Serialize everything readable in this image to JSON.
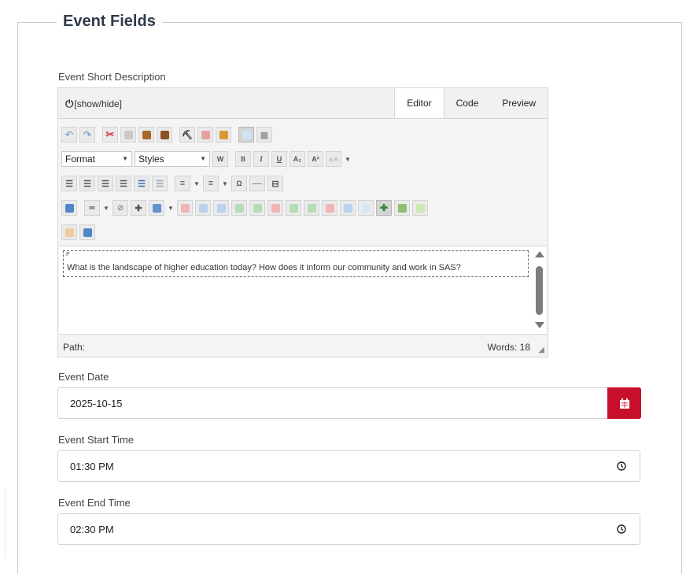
{
  "section": {
    "legend": "Event Fields"
  },
  "short_description": {
    "label": "Event Short Description",
    "editor": {
      "toggle_label": "[show/hide]",
      "tabs": [
        {
          "label": "Editor",
          "active": true
        },
        {
          "label": "Code",
          "active": false
        },
        {
          "label": "Preview",
          "active": false
        }
      ],
      "format_select": "Format",
      "styles_select": "Styles",
      "toolbar_text": {
        "b_paste_word": "W",
        "bold": "B",
        "italic": "I",
        "underline": "U",
        "subscript": "A₂",
        "superscript": "A²",
        "case": "a A",
        "special_char": "Ω"
      },
      "element_tag": "P",
      "content": "What is the landscape of higher education today? How does it inform our community and work in SAS?",
      "path_label": "Path:",
      "word_count": "Words: 18"
    }
  },
  "event_date": {
    "label": "Event Date",
    "value": "2025-10-15",
    "button_color": "#c8102e"
  },
  "start_time": {
    "label": "Event Start Time",
    "value": "01:30 PM"
  },
  "end_time": {
    "label": "Event End Time",
    "value": "02:30 PM"
  }
}
